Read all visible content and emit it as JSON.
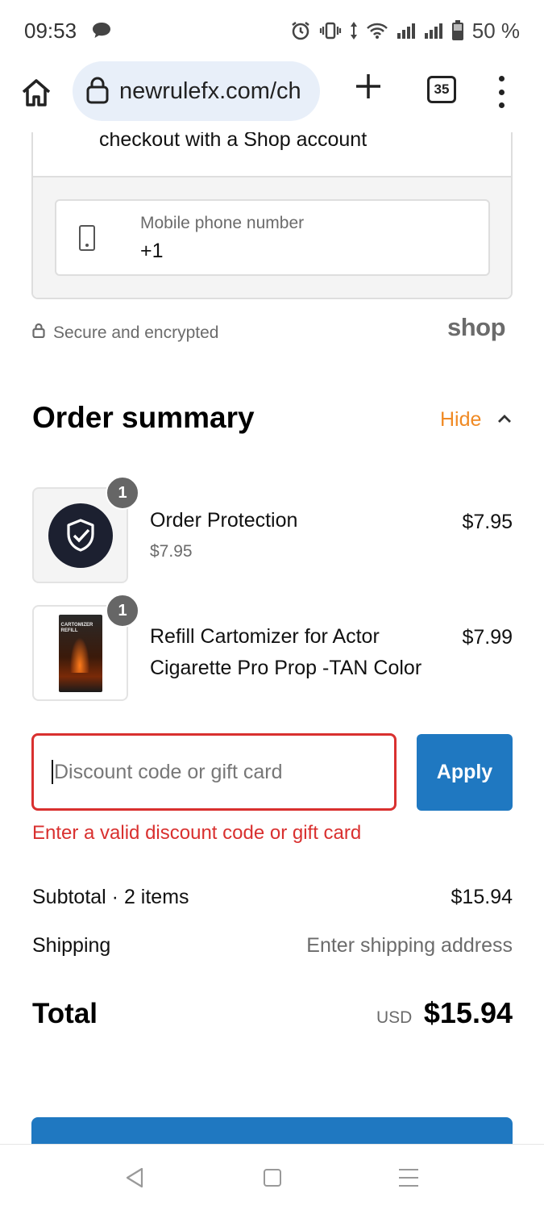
{
  "status_bar": {
    "time": "09:53",
    "battery": "50 %",
    "icons": [
      "chat-bubble-icon",
      "alarm-icon",
      "vibrate-icon",
      "data-arrows-icon",
      "wifi-icon",
      "signal-icon",
      "signal-icon",
      "battery-icon"
    ]
  },
  "browser": {
    "url": "newrulefx.com/ch",
    "tab_count": "35"
  },
  "shop_account": {
    "heading": "checkout with a Shop account",
    "phone_label": "Mobile phone number",
    "phone_value": "+1",
    "secure_text": "Secure and encrypted",
    "shop_logo": "shop"
  },
  "order_summary": {
    "title": "Order summary",
    "toggle_label": "Hide",
    "items": [
      {
        "name": "Order Protection",
        "unit_price": "$7.95",
        "price": "$7.95",
        "quantity": "1"
      },
      {
        "name": "Refill Cartomizer for Actor Cigarette Pro Prop -TAN Color",
        "price": "$7.99",
        "quantity": "1",
        "box_text": "CARTOMIZER REFILL"
      }
    ]
  },
  "discount": {
    "placeholder": "Discount code or gift card",
    "apply_label": "Apply",
    "error": "Enter a valid discount code or gift card"
  },
  "totals": {
    "subtotal_label": "Subtotal · 2 items",
    "subtotal_value": "$15.94",
    "shipping_label": "Shipping",
    "shipping_value": "Enter shipping address",
    "total_label": "Total",
    "total_currency": "USD",
    "total_value": "$15.94"
  },
  "colors": {
    "accent_orange": "#f08a24",
    "primary_blue": "#1f78c1",
    "error_red": "#d9302f"
  }
}
